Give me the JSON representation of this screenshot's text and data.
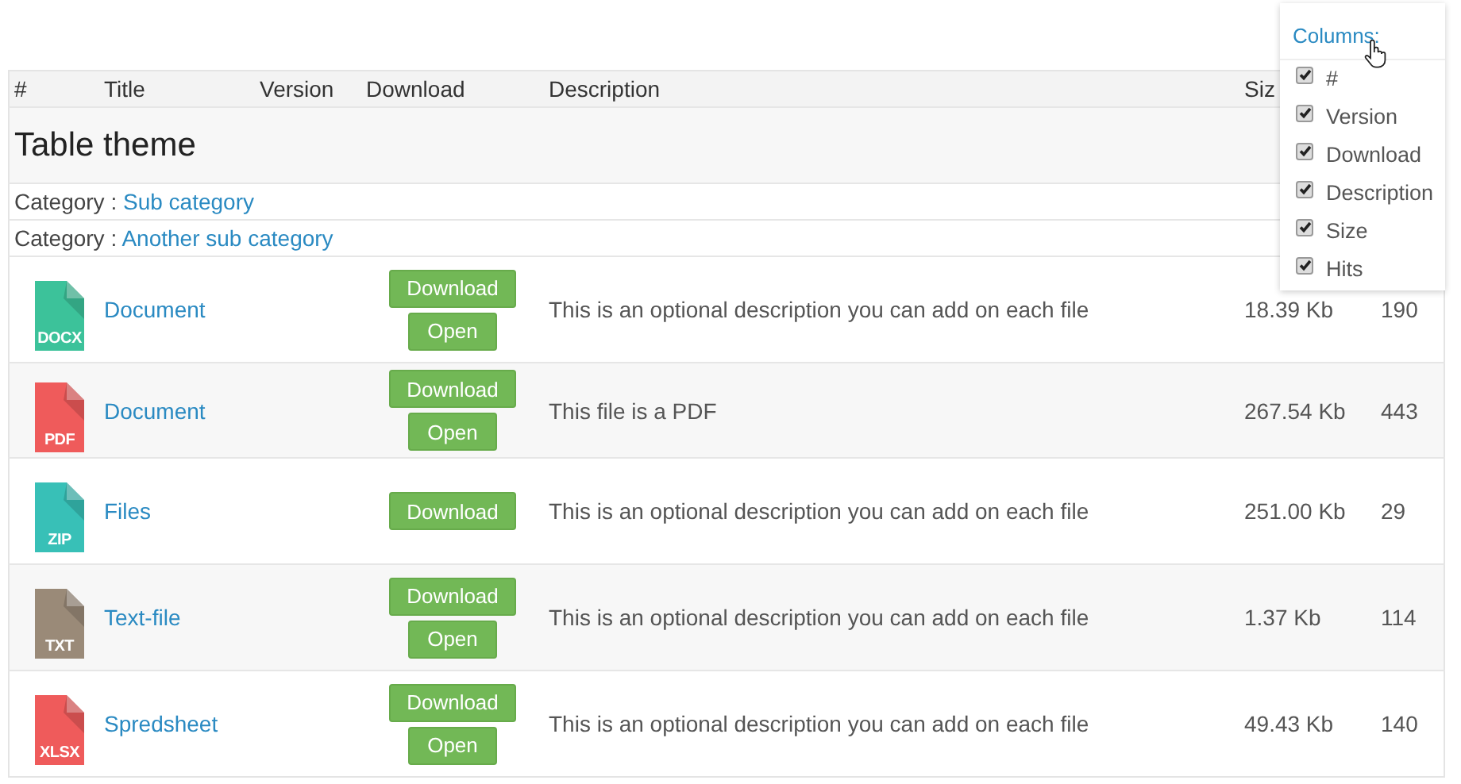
{
  "table": {
    "columns": [
      "#",
      "Title",
      "Version",
      "Download",
      "Description",
      "Siz"
    ],
    "theme_title": "Table theme",
    "categories": [
      {
        "label": "Category :",
        "link": "Sub category"
      },
      {
        "label": "Category :",
        "link": "Another sub category"
      }
    ],
    "rows": [
      {
        "type": "DOCX",
        "color": "#3cc29a",
        "title": "Document",
        "buttons": [
          "Download",
          "Open"
        ],
        "description": "This is an optional description you can add on each file",
        "size": "18.39 Kb",
        "hits": "190"
      },
      {
        "type": "PDF",
        "color": "#ef5b5b",
        "title": "Document",
        "buttons": [
          "Download",
          "Open"
        ],
        "description": "This file is a PDF",
        "size": "267.54 Kb",
        "hits": "443"
      },
      {
        "type": "ZIP",
        "color": "#38c0b7",
        "title": "Files",
        "buttons": [
          "Download"
        ],
        "description": "This is an optional description you can add on each file",
        "size": "251.00 Kb",
        "hits": "29"
      },
      {
        "type": "TXT",
        "color": "#9a8a78",
        "title": "Text-file",
        "buttons": [
          "Download",
          "Open"
        ],
        "description": "This is an optional description you can add on each file",
        "size": "1.37 Kb",
        "hits": "114"
      },
      {
        "type": "XLSX",
        "color": "#ef5b5b",
        "title": "Spredsheet",
        "buttons": [
          "Download",
          "Open"
        ],
        "description": "This is an optional description you can add on each file",
        "size": "49.43 Kb",
        "hits": "140"
      }
    ]
  },
  "columns_menu": {
    "label": "Columns:",
    "options": [
      {
        "label": "#",
        "checked": true
      },
      {
        "label": "Version",
        "checked": true
      },
      {
        "label": "Download",
        "checked": true
      },
      {
        "label": "Description",
        "checked": true
      },
      {
        "label": "Size",
        "checked": true
      },
      {
        "label": "Hits",
        "checked": true
      }
    ]
  }
}
